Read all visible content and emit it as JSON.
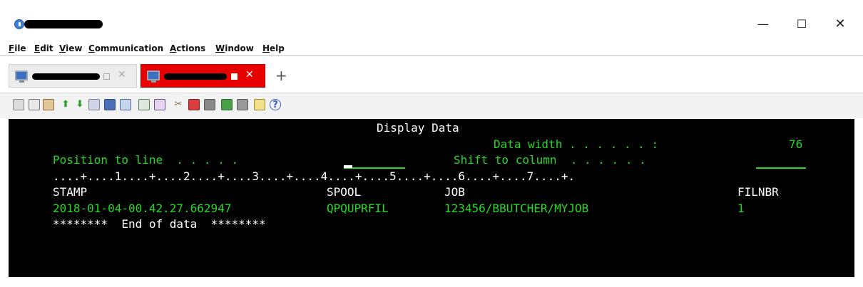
{
  "window": {
    "minimize_glyph": "—",
    "maximize_glyph": "☐",
    "close_glyph": "✕"
  },
  "menu": {
    "items": [
      {
        "first": "F",
        "rest": "ile"
      },
      {
        "first": "E",
        "rest": "dit"
      },
      {
        "first": "V",
        "rest": "iew"
      },
      {
        "first": "C",
        "rest": "ommunication"
      },
      {
        "first": "A",
        "rest": "ctions"
      },
      {
        "first": "W",
        "rest": "indow"
      },
      {
        "first": "H",
        "rest": "elp"
      }
    ]
  },
  "tabs": {
    "close_glyph": "✕",
    "add_glyph": "+"
  },
  "toolbar": {
    "icons": [
      "copy-icon",
      "paste-icon",
      "clipboard-icon",
      "send-file-icon",
      "receive-file-icon",
      "print-screen-icon",
      "macro-icon",
      "keypad-icon",
      "display-settings-icon",
      "grid-icon",
      "wrench-icon",
      "record-macro-icon",
      "stop-macro-icon",
      "play-macro-icon",
      "pause-macro-icon",
      "notes-icon",
      "help-icon"
    ]
  },
  "screen": {
    "title": "Display Data",
    "data_width_label": "Data width . . . . . . :",
    "data_width_value": "76",
    "position_label": "Position to line  . . . . .",
    "shift_label": "Shift to column  . . . . . .",
    "ruler": "....+....1....+....2....+....3....+....4....+....5....+....6....+....7....+.",
    "columns": {
      "stamp": "STAMP",
      "spool": "SPOOL",
      "job": "JOB",
      "filnbr": "FILNBR"
    },
    "row": {
      "stamp": "2018-01-04-00.42.27.662947",
      "spool": "QPQUPRFIL",
      "job": "123456/BBUTCHER/MYJOB",
      "filnbr": "1"
    },
    "end_of_data": "********  End of data  ********"
  },
  "colors": {
    "terminal_bg": "#000000",
    "terminal_green": "#22d922",
    "terminal_white": "#ffffff",
    "active_tab": "#e60000"
  }
}
